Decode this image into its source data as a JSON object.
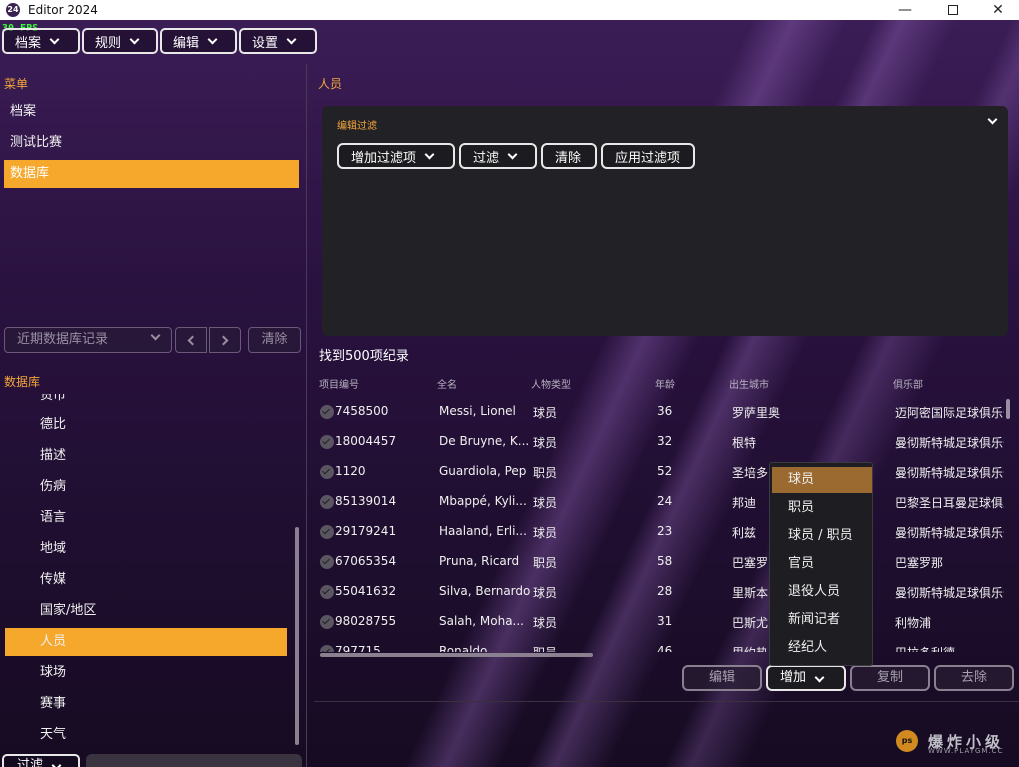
{
  "window": {
    "title": "Editor 2024",
    "fps": "30 FPS",
    "logo": "24"
  },
  "top_menu": [
    {
      "label": "档案"
    },
    {
      "label": "规则"
    },
    {
      "label": "编辑"
    },
    {
      "label": "设置"
    }
  ],
  "left": {
    "menu_label": "菜单",
    "menu_items": [
      {
        "label": "档案"
      },
      {
        "label": "测试比赛"
      },
      {
        "label": "数据库",
        "active": true
      }
    ],
    "recent_placeholder": "近期数据库记录",
    "clear_label": "清除",
    "db_label": "数据库",
    "db_items": [
      {
        "label": "货币"
      },
      {
        "label": "德比"
      },
      {
        "label": "描述"
      },
      {
        "label": "伤病"
      },
      {
        "label": "语言"
      },
      {
        "label": "地域"
      },
      {
        "label": "传媒"
      },
      {
        "label": "国家/地区"
      },
      {
        "label": "人员",
        "active": true
      },
      {
        "label": "球场"
      },
      {
        "label": "赛事"
      },
      {
        "label": "天气"
      }
    ],
    "bottom_filter_label": "过滤"
  },
  "main": {
    "title": "人员",
    "filter_panel": {
      "label": "编辑过滤",
      "add_filter": "增加过滤项",
      "filter": "过滤",
      "clear": "清除",
      "apply": "应用过滤项"
    },
    "found_text": "找到500项纪录",
    "columns": [
      "项目编号",
      "全名",
      "人物类型",
      "年龄",
      "出生城市",
      "俱乐部"
    ],
    "rows": [
      {
        "id": "7458500",
        "name": "Messi, Lionel",
        "type": "球员",
        "age": "36",
        "city": "罗萨里奥",
        "club": "迈阿密国际足球俱乐部"
      },
      {
        "id": "18004457",
        "name": "De Bruyne, K...",
        "type": "球员",
        "age": "32",
        "city": "根特",
        "club": "曼彻斯特城足球俱乐部"
      },
      {
        "id": "1120",
        "name": "Guardiola, Pep",
        "type": "职员",
        "age": "52",
        "city": "圣培多",
        "club": "曼彻斯特城足球俱乐部"
      },
      {
        "id": "85139014",
        "name": "Mbappé, Kyli...",
        "type": "球员",
        "age": "24",
        "city": "邦迪",
        "club": "巴黎圣日耳曼足球俱乐部"
      },
      {
        "id": "29179241",
        "name": "Haaland, Erli...",
        "type": "球员",
        "age": "23",
        "city": "利兹",
        "club": "曼彻斯特城足球俱乐部"
      },
      {
        "id": "67065354",
        "name": "Pruna, Ricard",
        "type": "职员",
        "age": "58",
        "city": "巴塞罗",
        "club": "巴塞罗那"
      },
      {
        "id": "55041632",
        "name": "Silva, Bernardo",
        "type": "球员",
        "age": "28",
        "city": "里斯本",
        "club": "曼彻斯特城足球俱乐部"
      },
      {
        "id": "98028755",
        "name": "Salah, Moha...",
        "type": "球员",
        "age": "31",
        "city": "巴斯尤",
        "club": "利物浦"
      },
      {
        "id": "797715",
        "name": "Ronaldo",
        "type": "职员",
        "age": "46",
        "city": "里约热",
        "club": "巴拉多利德"
      }
    ],
    "actions": {
      "edit": "编辑",
      "add": "增加",
      "copy": "复制",
      "delete": "去除"
    },
    "add_dropdown": [
      "球员",
      "职员",
      "球员 / 职员",
      "官员",
      "退役人员",
      "新闻记者",
      "经纪人"
    ],
    "add_dropdown_highlight": 0
  },
  "watermark": {
    "logo": "ps",
    "text": "爆炸小级",
    "sub": "WWW.PLAYGM.CC"
  }
}
